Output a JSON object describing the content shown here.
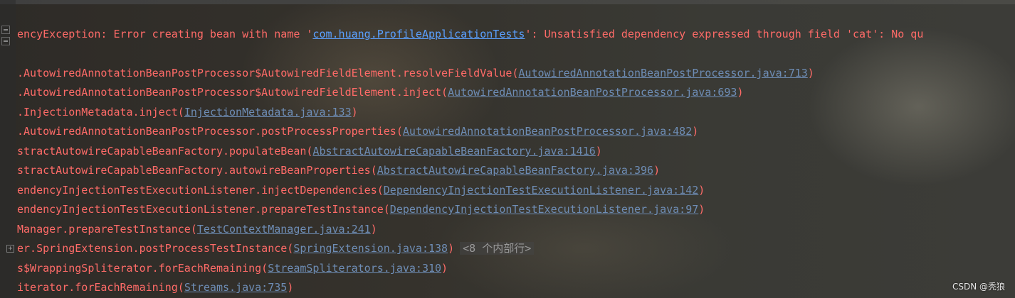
{
  "console": {
    "error_line": {
      "prefix": "encyException: Error creating bean with name '",
      "bean": "com.huang.ProfileApplicationTests",
      "suffix": "': Unsatisfied dependency expressed through field 'cat': No qu"
    },
    "frames": [
      {
        "call": ".AutowiredAnnotationBeanPostProcessor$AutowiredFieldElement.resolveFieldValue(",
        "source": "AutowiredAnnotationBeanPostProcessor.java:713",
        "end": ")"
      },
      {
        "call": ".AutowiredAnnotationBeanPostProcessor$AutowiredFieldElement.inject(",
        "source": "AutowiredAnnotationBeanPostProcessor.java:693",
        "end": ")"
      },
      {
        "call": ".InjectionMetadata.inject(",
        "source": "InjectionMetadata.java:133",
        "end": ")"
      },
      {
        "call": ".AutowiredAnnotationBeanPostProcessor.postProcessProperties(",
        "source": "AutowiredAnnotationBeanPostProcessor.java:482",
        "end": ")"
      },
      {
        "call": "stractAutowireCapableBeanFactory.populateBean(",
        "source": "AbstractAutowireCapableBeanFactory.java:1416",
        "end": ")"
      },
      {
        "call": "stractAutowireCapableBeanFactory.autowireBeanProperties(",
        "source": "AbstractAutowireCapableBeanFactory.java:396",
        "end": ")"
      },
      {
        "call": "endencyInjectionTestExecutionListener.injectDependencies(",
        "source": "DependencyInjectionTestExecutionListener.java:142",
        "end": ")"
      },
      {
        "call": "endencyInjectionTestExecutionListener.prepareTestInstance(",
        "source": "DependencyInjectionTestExecutionListener.java:97",
        "end": ")"
      },
      {
        "call": "Manager.prepareTestInstance(",
        "source": "TestContextManager.java:241",
        "end": ")"
      },
      {
        "call": "er.SpringExtension.postProcessTestInstance(",
        "source": "SpringExtension.java:138",
        "end": ")",
        "folded": "<8 个内部行>"
      },
      {
        "call": "s$WrappingSpliterator.forEachRemaining(",
        "source": "StreamSpliterators.java:310",
        "end": ")"
      },
      {
        "call": "iterator.forEachRemaining(",
        "source": "Streams.java:735",
        "end": ")"
      }
    ]
  },
  "watermark": "CSDN @秃狼",
  "colors": {
    "error_text": "#ff6b68",
    "link": "#6e8db5",
    "bean_link": "#5aa0ff",
    "folded_text": "#9a9a9a"
  }
}
